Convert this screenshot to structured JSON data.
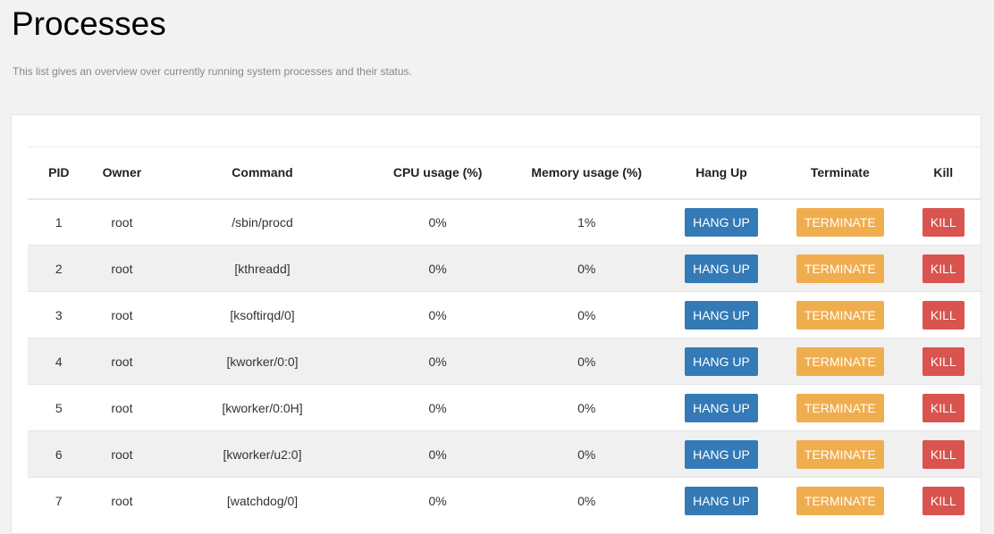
{
  "page": {
    "title": "Processes",
    "description": "This list gives an overview over currently running system processes and their status."
  },
  "table": {
    "headers": {
      "pid": "PID",
      "owner": "Owner",
      "command": "Command",
      "cpu": "CPU usage (%)",
      "memory": "Memory usage (%)",
      "hangup": "Hang Up",
      "terminate": "Terminate",
      "kill": "Kill"
    },
    "button_labels": {
      "hangup": "HANG UP",
      "terminate": "TERMINATE",
      "kill": "KILL"
    },
    "rows": [
      {
        "pid": "1",
        "owner": "root",
        "command": "/sbin/procd",
        "cpu": "0%",
        "memory": "1%"
      },
      {
        "pid": "2",
        "owner": "root",
        "command": "[kthreadd]",
        "cpu": "0%",
        "memory": "0%"
      },
      {
        "pid": "3",
        "owner": "root",
        "command": "[ksoftirqd/0]",
        "cpu": "0%",
        "memory": "0%"
      },
      {
        "pid": "4",
        "owner": "root",
        "command": "[kworker/0:0]",
        "cpu": "0%",
        "memory": "0%"
      },
      {
        "pid": "5",
        "owner": "root",
        "command": "[kworker/0:0H]",
        "cpu": "0%",
        "memory": "0%"
      },
      {
        "pid": "6",
        "owner": "root",
        "command": "[kworker/u2:0]",
        "cpu": "0%",
        "memory": "0%"
      },
      {
        "pid": "7",
        "owner": "root",
        "command": "[watchdog/0]",
        "cpu": "0%",
        "memory": "0%"
      }
    ]
  },
  "colors": {
    "hangup": "#337ab7",
    "terminate": "#f0ad4e",
    "kill": "#d9534f"
  }
}
